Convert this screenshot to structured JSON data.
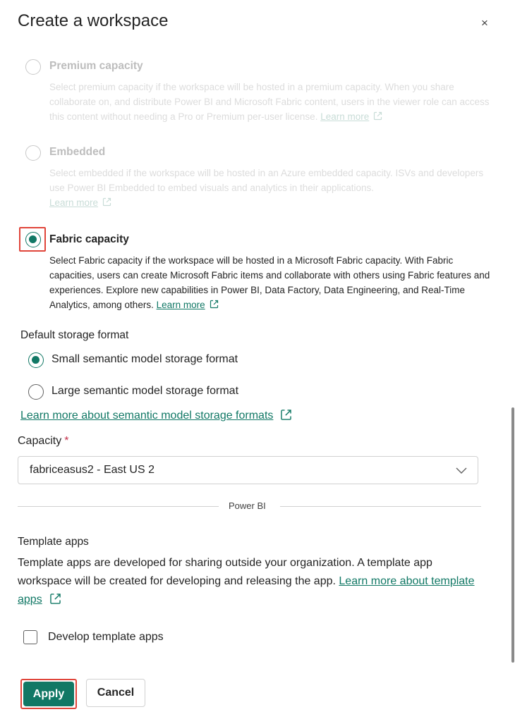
{
  "dialog": {
    "title": "Create a workspace",
    "close_symbol": "×"
  },
  "options": [
    {
      "label": "Premium capacity",
      "desc": "Select premium capacity if the workspace will be hosted in a premium capacity. When you share collaborate on, and distribute Power BI and Microsoft Fabric content, users in the viewer role can access this content without needing a Pro or Premium per-user license.",
      "link": "Learn more",
      "selected": false,
      "disabled": true
    },
    {
      "label": "Embedded",
      "desc": "Select embedded if the workspace will be hosted in an Azure embedded capacity. ISVs and developers use Power BI Embedded to embed visuals and analytics in their applications.",
      "link": "Learn more",
      "selected": false,
      "disabled": true
    },
    {
      "label": "Fabric capacity",
      "desc": "Select Fabric capacity if the workspace will be hosted in a Microsoft Fabric capacity. With Fabric capacities, users can create Microsoft Fabric items and collaborate with others using Fabric features and experiences. Explore new capabilities in Power BI, Data Factory, Data Engineering, and Real-Time Analytics, among others.",
      "link": "Learn more",
      "selected": true,
      "disabled": false
    }
  ],
  "storage": {
    "heading": "Default storage format",
    "small_label": "Small semantic model storage format",
    "large_label": "Large semantic model storage format",
    "selected": "small",
    "learn_link": "Learn more about semantic model storage formats"
  },
  "capacity": {
    "label": "Capacity",
    "required_mark": "*",
    "value": "fabriceasus2 - East US 2"
  },
  "divider_text": "Power BI",
  "template_apps": {
    "heading": "Template apps",
    "desc": "Template apps are developed for sharing outside your organization. A template app workspace will be created for developing and releasing the app.",
    "link": "Learn more about template apps",
    "checkbox_label": "Develop template apps",
    "checked": false
  },
  "footer": {
    "apply_label": "Apply",
    "cancel_label": "Cancel"
  },
  "colors": {
    "accent": "#117865",
    "highlight": "#e0453a",
    "required": "#c4314b"
  },
  "icons": {
    "close": "close-icon",
    "external_link": "external-link-icon",
    "dropdown": "chevron-down-icon"
  }
}
